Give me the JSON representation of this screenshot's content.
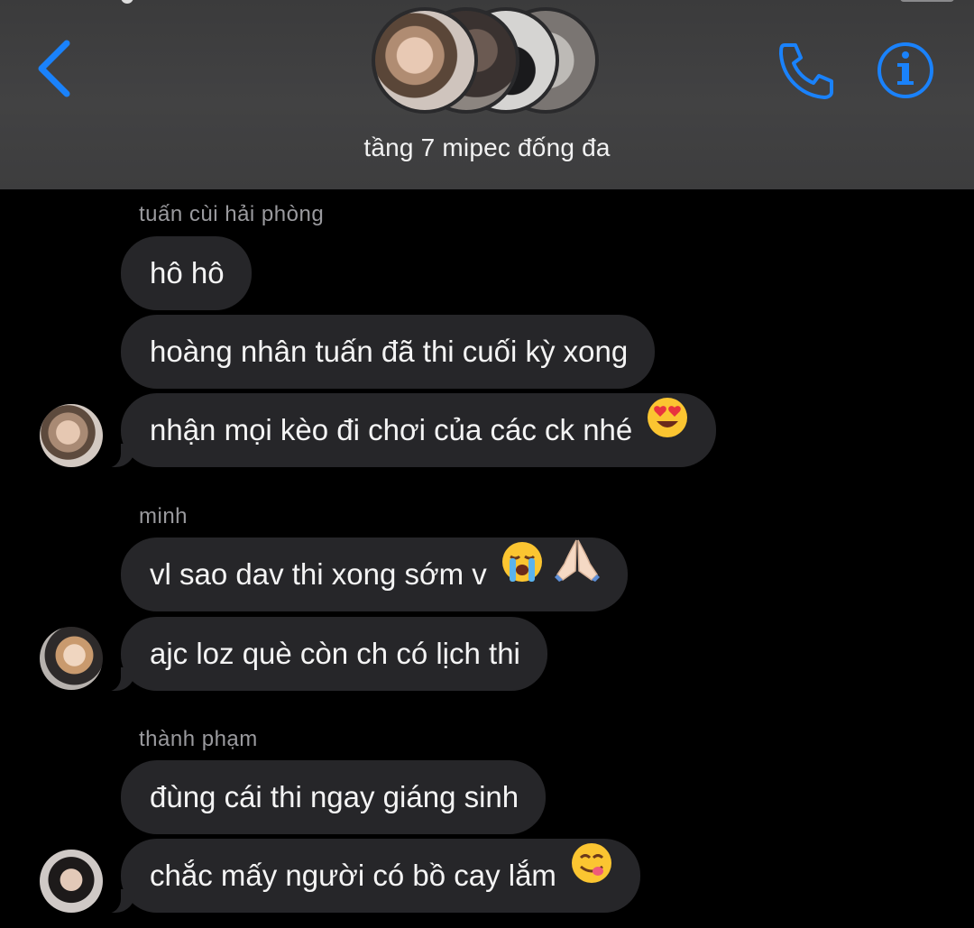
{
  "header": {
    "group_title": "tầng 7 mipec đống đa",
    "accent_color": "#1a82fb",
    "back_icon": "chevron-left-icon",
    "call_icon": "phone-icon",
    "info_icon": "info-icon",
    "member_avatars": [
      "member-avatar-1",
      "member-avatar-2",
      "member-avatar-3",
      "member-avatar-4"
    ]
  },
  "messages": {
    "group1": {
      "sender": "tuấn cùi hải phòng",
      "m1": "hô hô",
      "m2": "hoàng nhân tuấn đã thi cuối kỳ xong",
      "m3": "nhận mọi kèo đi chơi của các ck nhé",
      "m3_emoji": "heart-eyes-emoji"
    },
    "group2": {
      "sender": "minh",
      "m1": "vl sao dav thi xong sớm v",
      "m1_emojis": [
        "crying-emoji",
        "praying-hands-emoji"
      ],
      "m2": "ajc loz què còn ch có lịch thi"
    },
    "group3": {
      "sender": "thành phạm",
      "m1": "đùng cái thi ngay giáng sinh",
      "m2": "chắc mấy người có bồ cay lắm",
      "m2_emoji": "yum-emoji"
    }
  },
  "colors": {
    "background": "#000000",
    "header_bg": "#404041",
    "bubble_bg": "#262629",
    "sender_name": "#9a9a9e",
    "message_text": "#f4f4f4"
  }
}
